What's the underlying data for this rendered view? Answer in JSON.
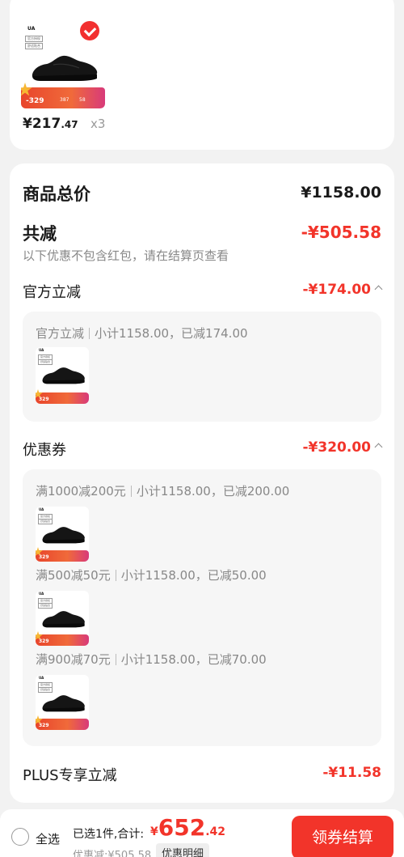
{
  "item": {
    "brand_mark": "UA",
    "tag1": "官方授权",
    "tag2": "舒适贴合",
    "promo_price": "329",
    "promo_b": "387",
    "promo_c": "58",
    "price_main": "¥217",
    "price_decimal": ".47",
    "qty": "x3",
    "selected": true
  },
  "summary": {
    "total_label": "商品总价",
    "total_value": "¥1158.00",
    "reduce_label": "共减",
    "reduce_value": "-¥505.58",
    "reduce_note": "以下优惠不包含红包，请在结算页查看"
  },
  "official": {
    "label": "官方立减",
    "value": "-¥174.00",
    "line_name": "官方立减",
    "line_detail": "小计1158.00，已减174.00"
  },
  "coupons": {
    "label": "优惠券",
    "value": "-¥320.00",
    "items": [
      {
        "name": "满1000减200元",
        "detail": "小计1158.00，已减200.00"
      },
      {
        "name": "满500减50元",
        "detail": "小计1158.00，已减50.00"
      },
      {
        "name": "满900减70元",
        "detail": "小计1158.00，已减70.00"
      }
    ]
  },
  "plus": {
    "label": "PLUS专享立减",
    "value": "-¥11.58"
  },
  "bottom": {
    "select_all": "全选",
    "selected_text": "已选1件,合计:",
    "currency": "¥",
    "total_int": "652",
    "total_dec": ".42",
    "discount_text": "优惠减:¥505.58",
    "discount_detail": "优惠明细",
    "checkout": "领券结算"
  },
  "colors": {
    "accent": "#f2342a",
    "background": "#f2f2f2"
  }
}
